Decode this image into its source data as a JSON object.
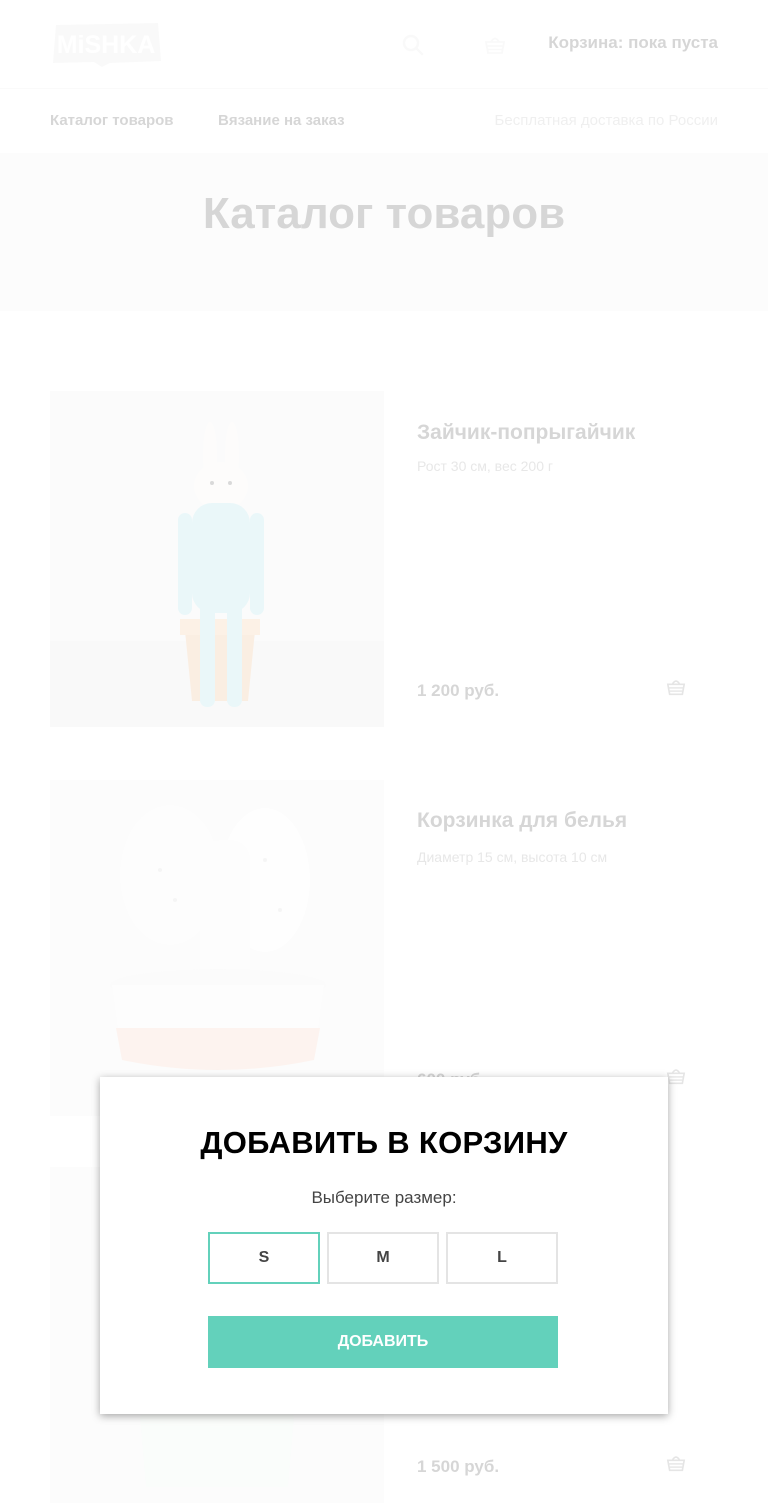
{
  "header": {
    "logo_text": "MiSHKA",
    "cart_text": "Корзина: пока пуста"
  },
  "nav": {
    "items": [
      {
        "label": "Каталог товаров"
      },
      {
        "label": "Вязание на заказ"
      }
    ],
    "delivery_note": "Бесплатная доставка по России"
  },
  "hero": {
    "title": "Каталог товаров"
  },
  "products": [
    {
      "title": "Зайчик-попрыгайчик",
      "description": "Рост 30 см, вес 200 г",
      "price": "1 200 руб."
    },
    {
      "title": "Корзинка для белья",
      "description": "Диаметр 15 см, высота 10 см",
      "price": "600 руб."
    },
    {
      "title": "",
      "description": "",
      "price": "1 500 руб."
    }
  ],
  "modal": {
    "title": "ДОБАВИТЬ В КОРЗИНУ",
    "subtitle": "Выберите размер:",
    "sizes": [
      "S",
      "M",
      "L"
    ],
    "selected_size": "S",
    "submit_label": "ДОБАВИТЬ"
  },
  "colors": {
    "accent": "#63d1bb",
    "text": "#444444",
    "muted": "#b5b5b5",
    "hero_bg": "#f2f2f2"
  },
  "icons": {
    "search": "search-icon",
    "cart": "basket-icon"
  }
}
